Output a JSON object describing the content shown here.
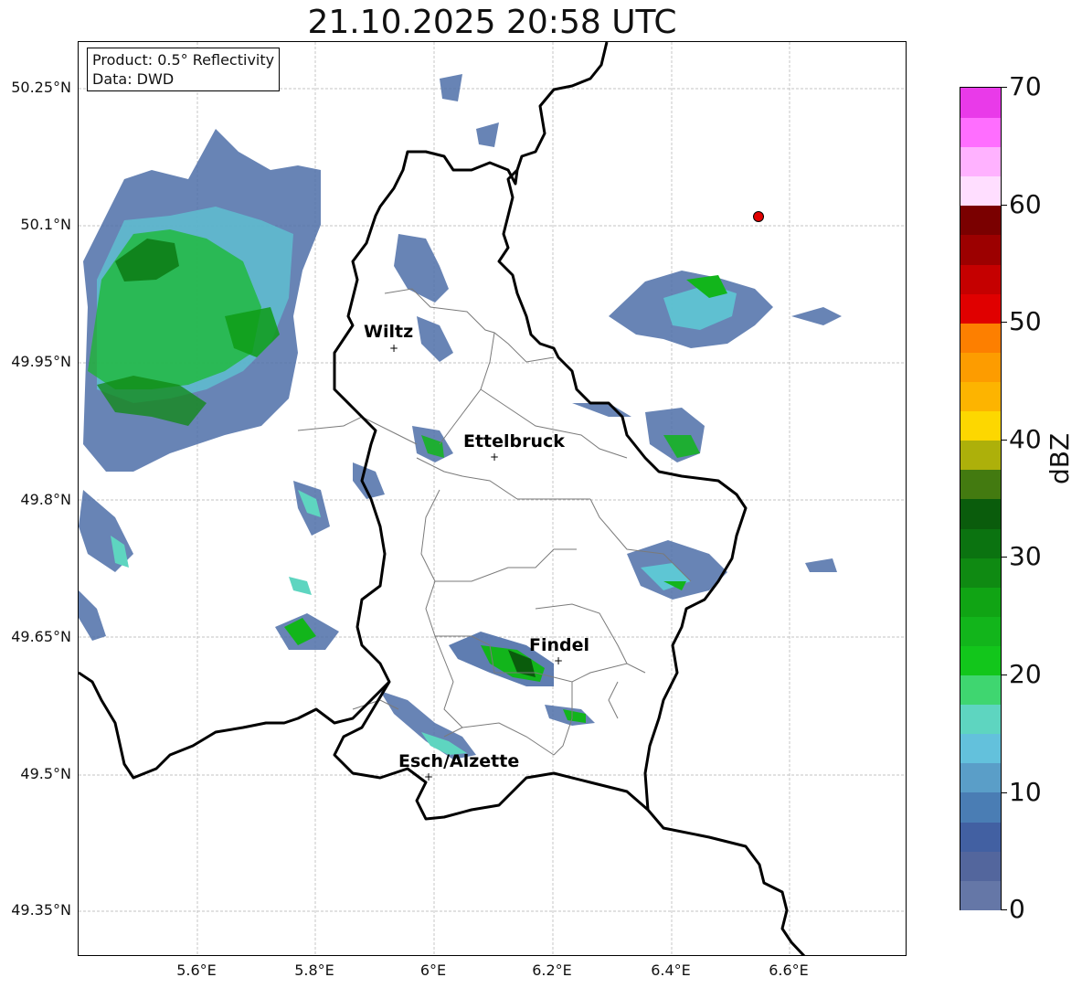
{
  "title": "21.10.2025 20:58 UTC",
  "product_box": {
    "line1": "Product: 0.5° Reflectivity",
    "line2": "Data: DWD"
  },
  "lat_ticks": [
    "50.25°N",
    "50.1°N",
    "49.95°N",
    "49.8°N",
    "49.65°N",
    "49.5°N",
    "49.35°N"
  ],
  "lon_ticks": [
    "5.6°E",
    "5.8°E",
    "6°E",
    "6.2°E",
    "6.4°E",
    "6.6°E"
  ],
  "cities": [
    "Wiltz",
    "Ettelbruck",
    "Findel",
    "Esch/Alzette"
  ],
  "colorbar": {
    "label": "dBZ",
    "ticks": [
      "0",
      "10",
      "20",
      "30",
      "40",
      "50",
      "60",
      "70"
    ],
    "colors": [
      "#6577a7",
      "#53669d",
      "#4260a2",
      "#4a7db4",
      "#5a9ec8",
      "#63c1dc",
      "#5ed5c0",
      "#3fd670",
      "#12c61b",
      "#12b51b",
      "#10a414",
      "#0f8a12",
      "#0b7310",
      "#0a5c0c",
      "#437a10",
      "#adb00a",
      "#fdd700",
      "#fdb400",
      "#fd9c00",
      "#fd7f00",
      "#e00000",
      "#c50000",
      "#9c0000",
      "#7a0000",
      "#ffdeff",
      "#ffb2ff",
      "#ff6eff",
      "#e93ae9"
    ]
  },
  "special_marker": {
    "type": "red-dot",
    "color": "#e00000"
  }
}
